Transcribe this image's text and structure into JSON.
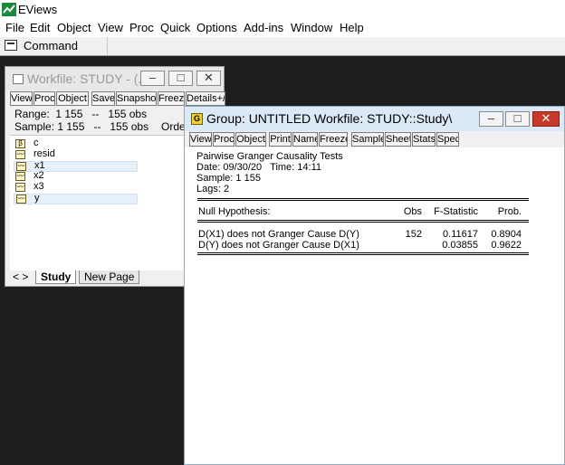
{
  "app": {
    "title": "EViews"
  },
  "menu": [
    "File",
    "Edit",
    "Object",
    "View",
    "Proc",
    "Quick",
    "Options",
    "Add-ins",
    "Window",
    "Help"
  ],
  "command_bar": {
    "label": "Command"
  },
  "workfile_window": {
    "title": "Workfile: STUDY - (...",
    "toolbar": [
      "View",
      "Proc",
      "Object",
      "Save",
      "Snapshot",
      "Freeze",
      "Details+/-"
    ],
    "range_line": "Range:  1 155   --   155 obs",
    "sample_line": "Sample: 1 155   --   155 obs",
    "order_label": "Orde",
    "objects": [
      {
        "name": "c",
        "icon": "coefficient-icon",
        "selected": false
      },
      {
        "name": "resid",
        "icon": "series-icon",
        "selected": false
      },
      {
        "name": "x1",
        "icon": "series-icon",
        "selected": true
      },
      {
        "name": "x2",
        "icon": "series-icon",
        "selected": false
      },
      {
        "name": "x3",
        "icon": "series-icon",
        "selected": false
      },
      {
        "name": "y",
        "icon": "series-icon",
        "selected": true
      }
    ],
    "tab_nav": "< >",
    "tabs": [
      "Study",
      "New Page"
    ]
  },
  "group_window": {
    "title": "Group: UNTITLED   Workfile: STUDY::Study\\",
    "toolbar": [
      "View",
      "Proc",
      "Object",
      "Print",
      "Name",
      "Freeze",
      "Sample",
      "Sheet",
      "Stats",
      "Spec"
    ],
    "output": {
      "heading": "Pairwise Granger Causality Tests",
      "date_line": "Date: 09/30/20   Time: 14:11",
      "sample_line": "Sample: 1 155",
      "lags_line": "Lags: 2",
      "col_hypothesis": "Null Hypothesis:",
      "col_obs": "Obs",
      "col_fstat": "F-Statistic",
      "col_prob": "Prob.",
      "rows": [
        {
          "hypothesis": "D(X1) does not Granger Cause D(Y)",
          "obs": "152",
          "fstat": "0.11617",
          "prob": "0.8904"
        },
        {
          "hypothesis": "D(Y) does not Granger Cause D(X1)",
          "obs": "",
          "fstat": "0.03855",
          "prob": "0.9622"
        }
      ]
    }
  }
}
